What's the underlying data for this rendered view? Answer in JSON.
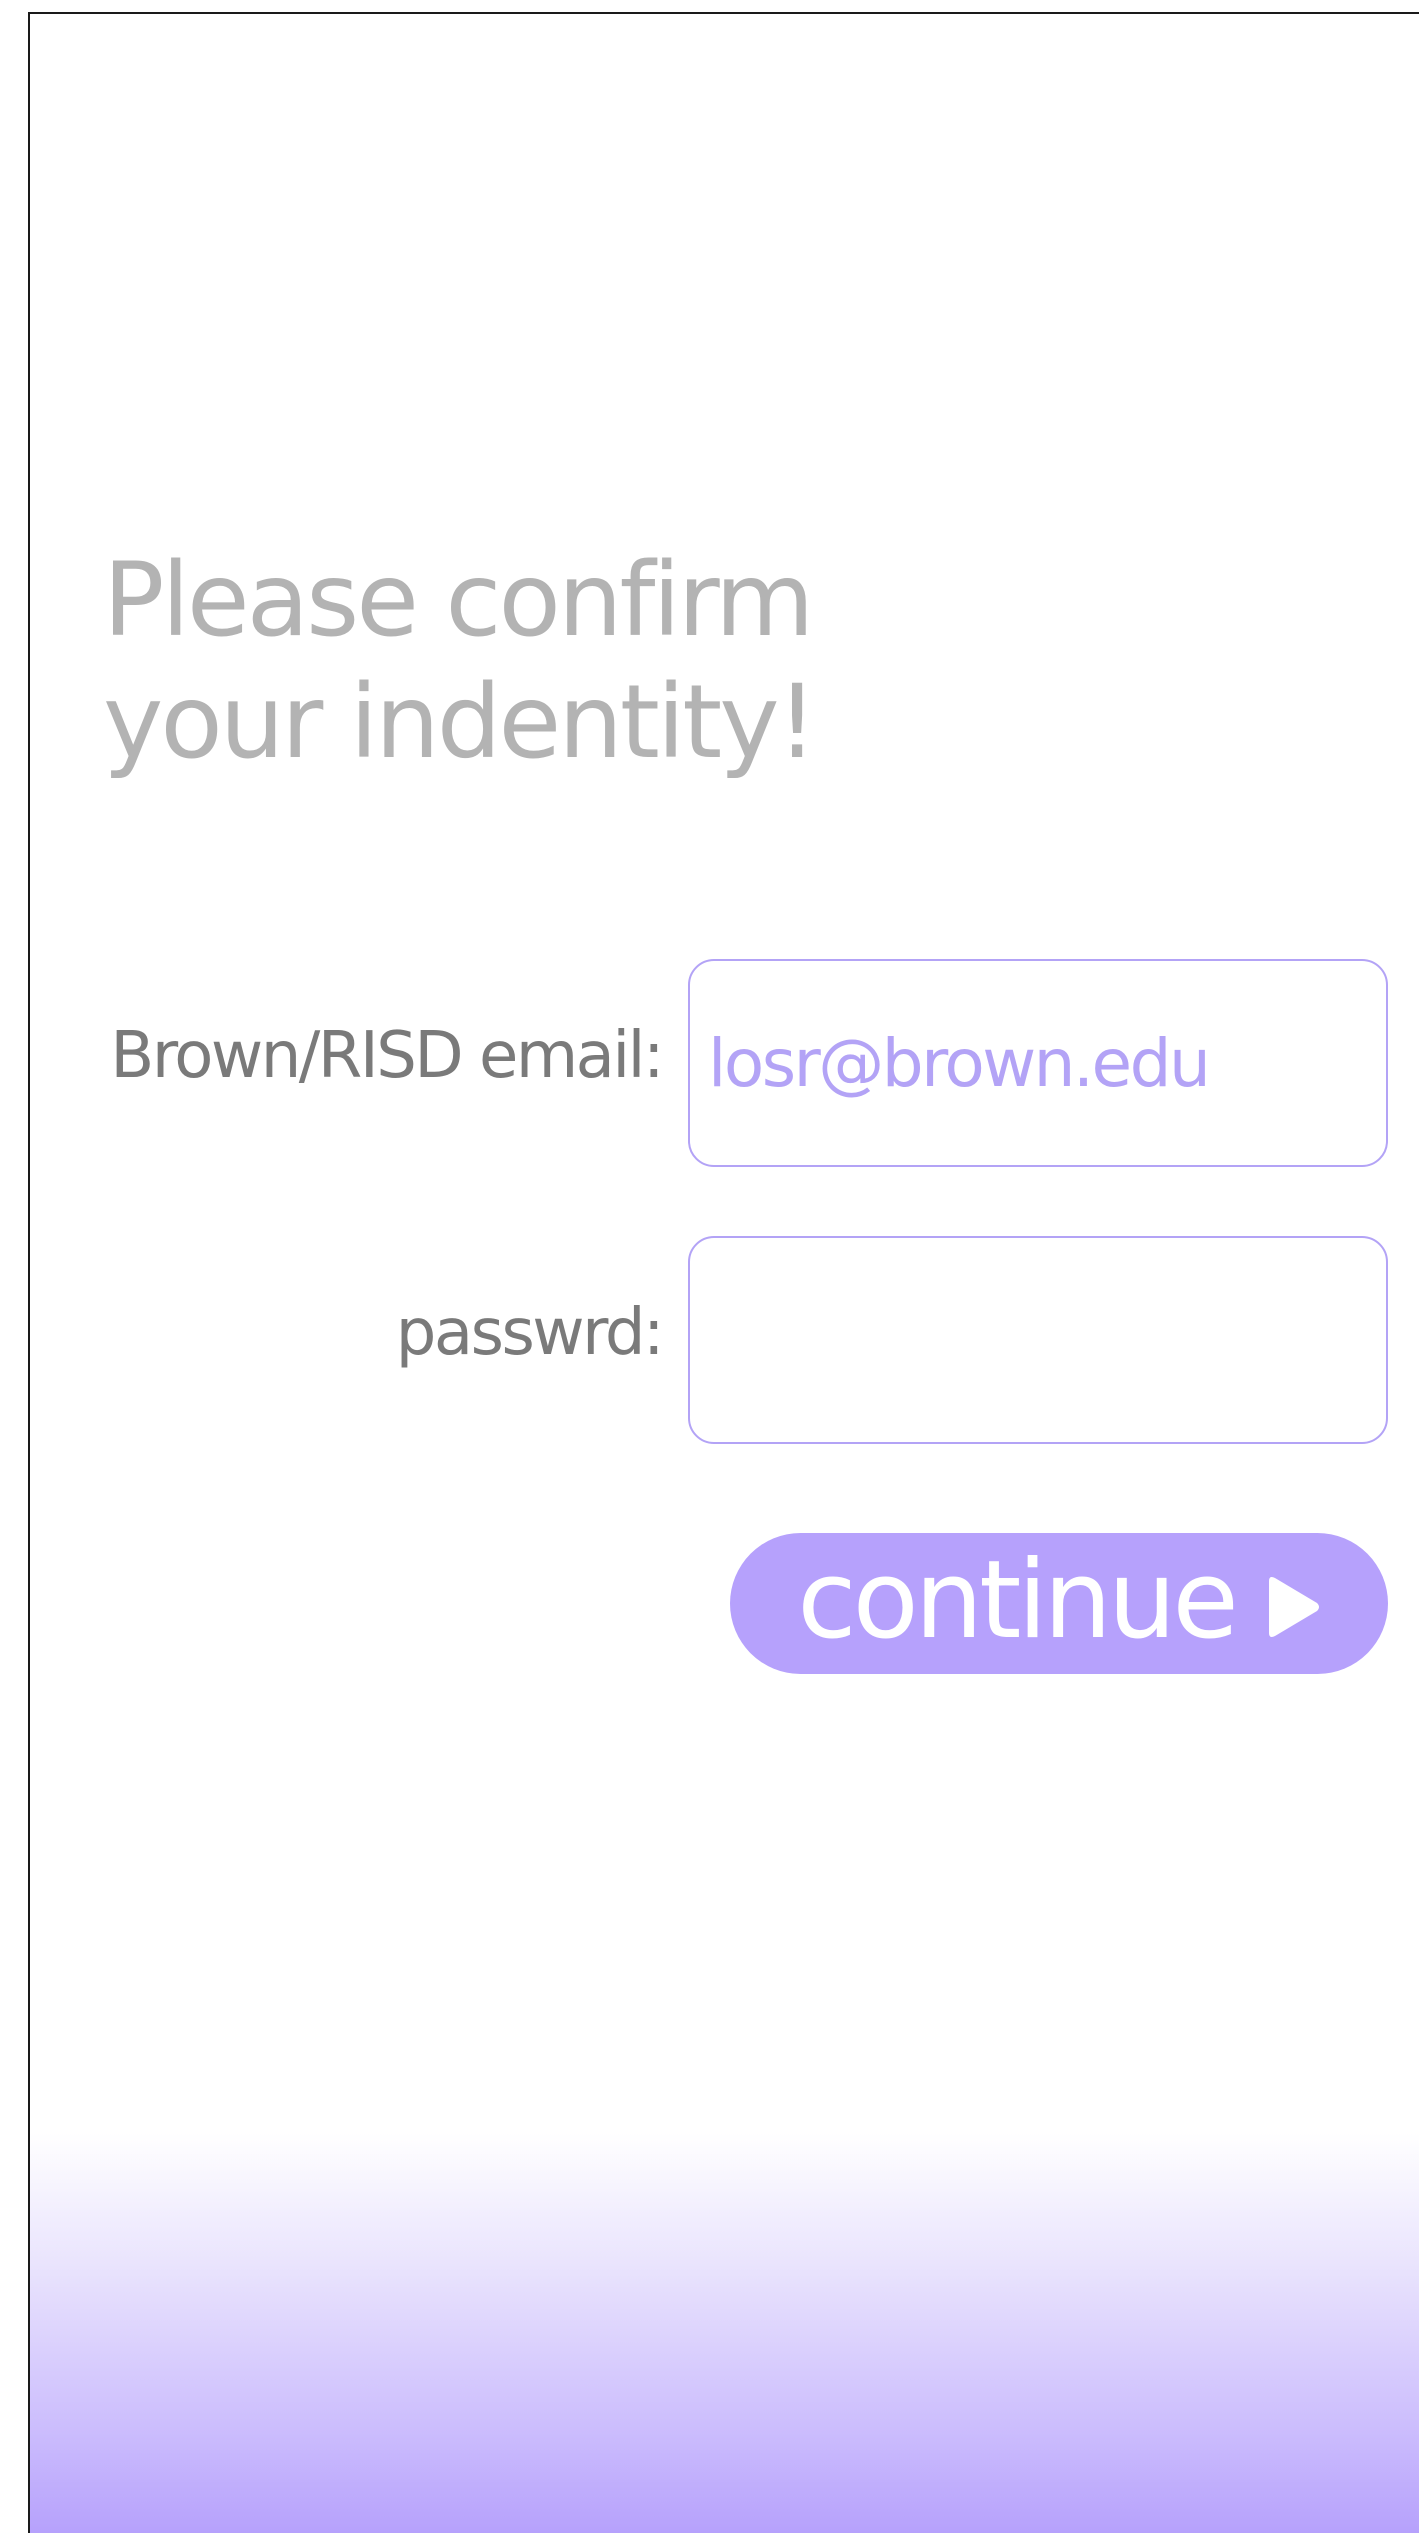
{
  "heading": {
    "line1": "Please confirm",
    "line2": "your indentity!"
  },
  "form": {
    "email_label": "Brown/RISD email:",
    "email_value": "losr@brown.edu",
    "password_label": "passwrd:",
    "password_value": ""
  },
  "continue_button": {
    "label": "continue",
    "icon": "play-icon"
  },
  "colors": {
    "accent": "#b6a1fc",
    "heading_text": "#b3b3b3",
    "label_text": "#7a7a7a",
    "input_border": "#b3a3f6"
  }
}
